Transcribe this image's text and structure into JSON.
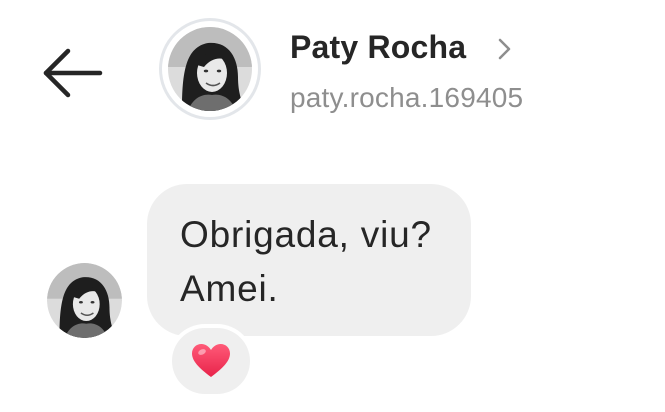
{
  "header": {
    "back_icon": "arrow-left-icon",
    "contact_name": "Paty Rocha",
    "username": "paty.rocha.169405",
    "chevron_icon": "chevron-right-icon",
    "avatar_ring_color": "#e3e6ea"
  },
  "conversation": {
    "messages": [
      {
        "sender": "Paty Rocha",
        "lines": [
          "Obrigada, viu?",
          "Amei."
        ],
        "bubble_color": "#efefef",
        "reaction": {
          "icon": "heart-icon",
          "color": "#f0335a"
        }
      }
    ]
  },
  "colors": {
    "text_primary": "#262626",
    "text_secondary": "#8e8e8e",
    "background": "#ffffff"
  }
}
